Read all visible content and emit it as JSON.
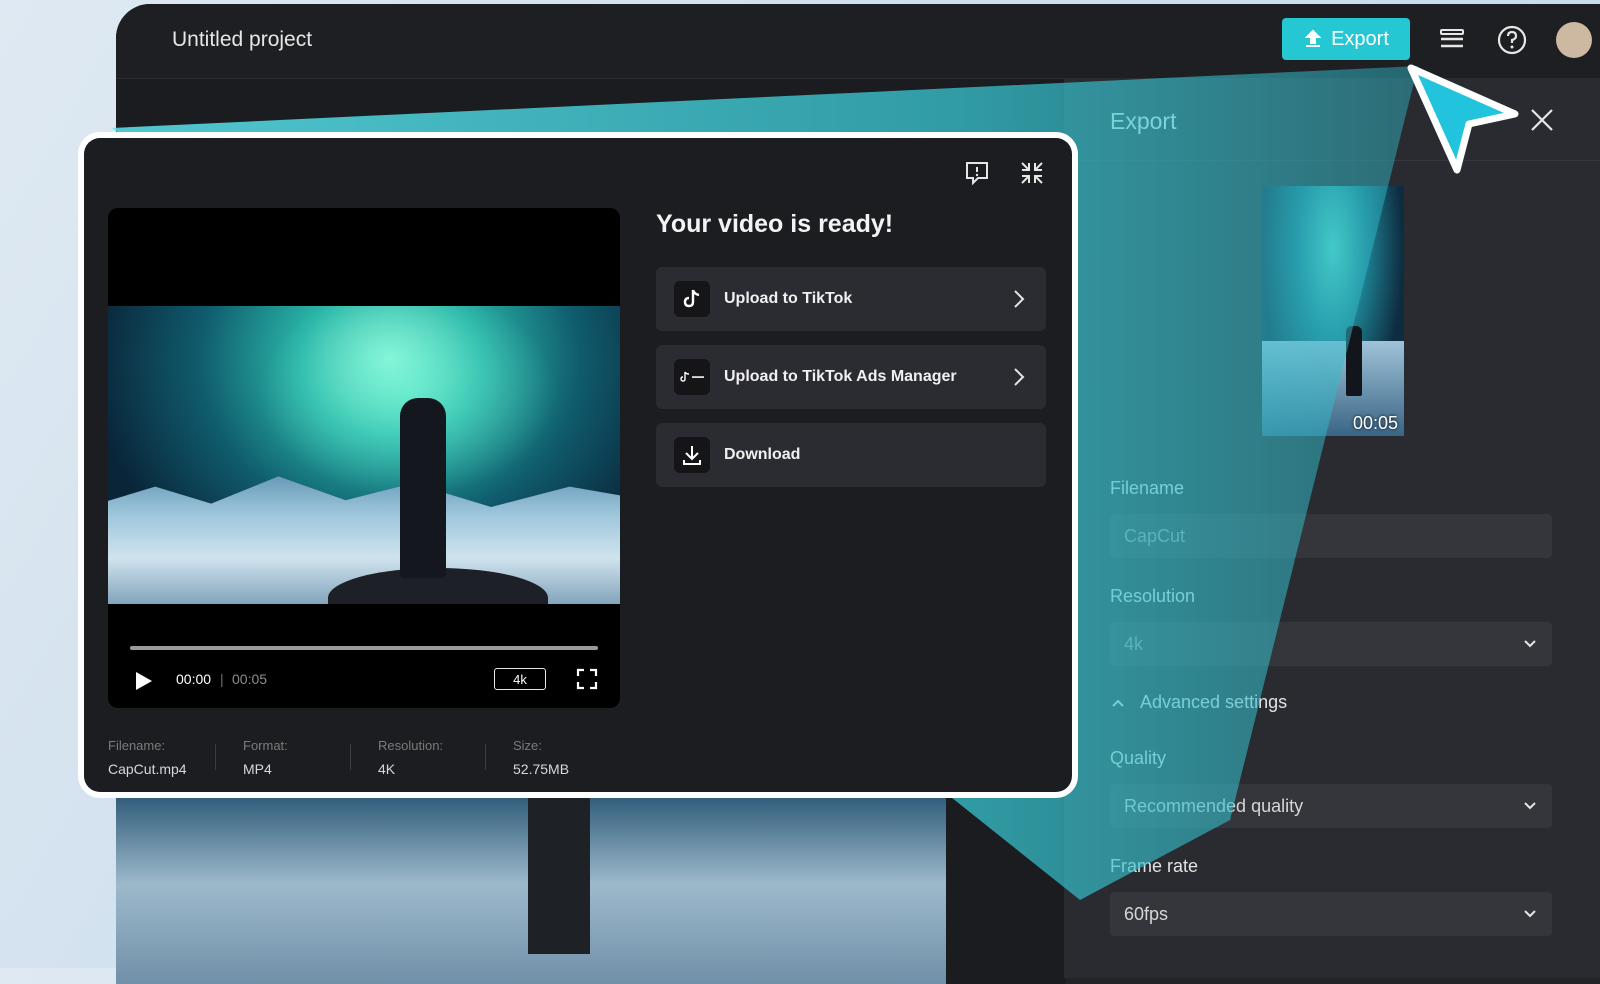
{
  "app": {
    "project_title": "Untitled project",
    "export_button": "Export",
    "accent_color": "#25c7d3"
  },
  "side_panel": {
    "title": "Export",
    "thumbnail_duration": "00:05",
    "filename_label": "Filename",
    "filename_value": "CapCut",
    "resolution_label": "Resolution",
    "resolution_value": "4k",
    "advanced_settings": "Advanced settings",
    "quality_label": "Quality",
    "quality_value": "Recommended quality",
    "frame_rate_label": "Frame rate",
    "frame_rate_value": "60fps"
  },
  "modal": {
    "heading": "Your video is ready!",
    "options": [
      {
        "label": "Upload to TikTok",
        "icon": "tiktok-icon"
      },
      {
        "label": "Upload to TikTok Ads Manager",
        "icon": "tiktok-ads-icon"
      },
      {
        "label": "Download",
        "icon": "download-icon"
      }
    ],
    "player": {
      "current_time": "00:00",
      "separator": "|",
      "duration": "00:05",
      "quality_badge": "4k",
      "progress": 0
    },
    "meta": [
      {
        "key": "Filename:",
        "value": "CapCut.mp4"
      },
      {
        "key": "Format:",
        "value": "MP4"
      },
      {
        "key": "Resolution:",
        "value": "4K"
      },
      {
        "key": "Size:",
        "value": "52.75MB"
      }
    ]
  }
}
